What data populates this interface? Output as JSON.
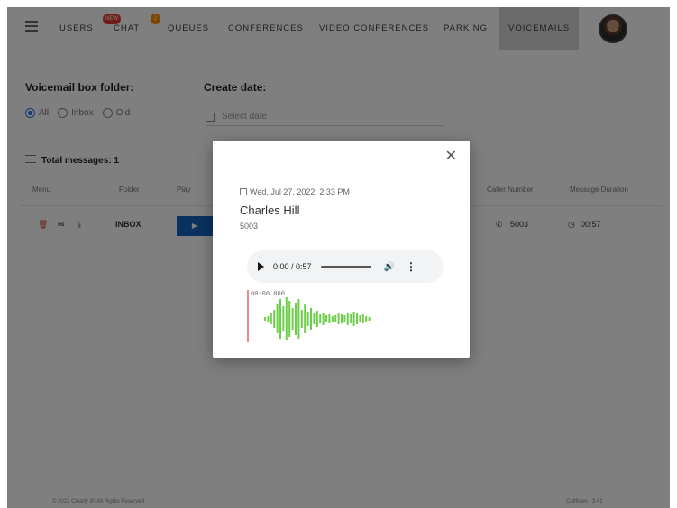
{
  "nav": {
    "items": [
      {
        "label": "USERS"
      },
      {
        "label": "CHAT"
      },
      {
        "label": "QUEUES"
      },
      {
        "label": "CONFERENCES"
      },
      {
        "label": "VIDEO CONFERENCES"
      },
      {
        "label": "PARKING"
      },
      {
        "label": "VOICEMAILS"
      }
    ],
    "chat_badge": "NEW",
    "chat_badge_color": "#e53935",
    "chat_count_badge": "2",
    "chat_count_badge_color": "#fb8c00",
    "active": "VOICEMAILS"
  },
  "filters": {
    "folder_label": "Voicemail box folder:",
    "options": [
      "All",
      "Inbox",
      "Old"
    ],
    "selected": "All",
    "date_label": "Create date:",
    "date_placeholder": "Select date"
  },
  "table": {
    "total_label": "Total messages: 1",
    "headers": [
      "Menu",
      "Folder",
      "Play",
      "Caller Number",
      "Message Duration"
    ],
    "rows": [
      {
        "folder": "INBOX",
        "caller": "5003",
        "duration": "00:57"
      }
    ]
  },
  "modal": {
    "date": "Wed, Jul 27, 2022, 2:33 PM",
    "name": "Charles Hill",
    "number": "5003",
    "audio_time": "0:00 / 0:57",
    "waveform_time": "00:00.000",
    "waveform_color": "#6ccf4a"
  },
  "footer": {
    "copyright": "© 2022 Clearly IP. All Rights Reserved.",
    "version": "Callflows | 3.41"
  }
}
